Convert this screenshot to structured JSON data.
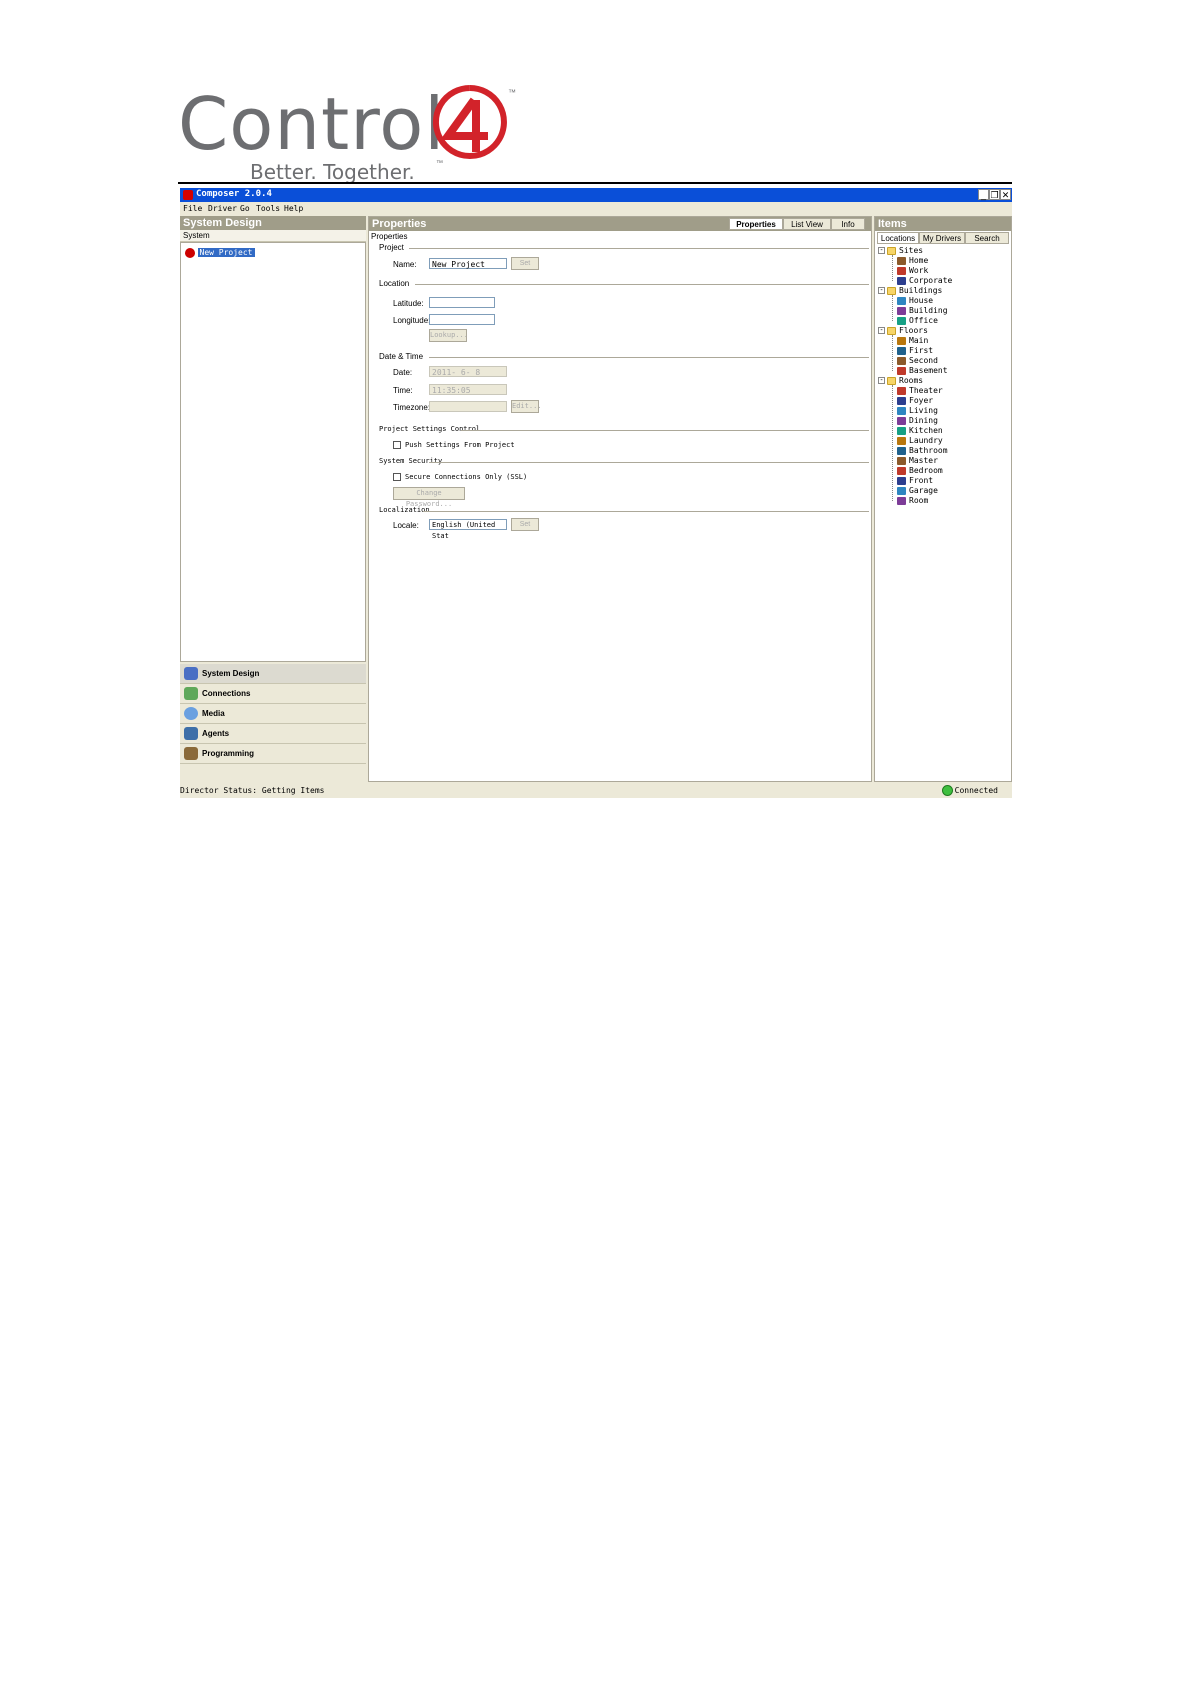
{
  "logo": {
    "word": "Control",
    "tagline": "Better. Together.",
    "tm": "™"
  },
  "window": {
    "title": "Composer 2.0.4"
  },
  "menu": [
    "File",
    "Driver",
    "Go",
    "Tools",
    "Help"
  ],
  "left": {
    "header": "System Design",
    "subheader": "System",
    "tree_root": "New Project",
    "nav": [
      "System Design",
      "Connections",
      "Media",
      "Agents",
      "Programming"
    ]
  },
  "center": {
    "header": "Properties",
    "tabs": [
      "Properties",
      "List View",
      "Info"
    ],
    "subheader": "Properties",
    "project": {
      "group": "Project",
      "name_label": "Name:",
      "name_value": "New Project",
      "set": "Set"
    },
    "location": {
      "group": "Location",
      "lat_label": "Latitude:",
      "lon_label": "Longitude:",
      "lookup": "Lookup..."
    },
    "datetime": {
      "group": "Date & Time",
      "date_label": "Date:",
      "date_value": "2011- 6- 8",
      "time_label": "Time:",
      "time_value": "11:35:05",
      "tz_label": "Timezone:",
      "edit": "Edit..."
    },
    "settings": {
      "group": "Project Settings Control",
      "push": "Push Settings From Project"
    },
    "security": {
      "group": "System Security",
      "secure": "Secure Connections Only (SSL)",
      "change": "Change Password..."
    },
    "localization": {
      "group": "Localization",
      "locale_label": "Locale:",
      "locale_value": "English (United Stat",
      "set": "Set"
    }
  },
  "right": {
    "header": "Items",
    "tabs": [
      "Locations",
      "My Drivers",
      "Search"
    ],
    "tree": [
      {
        "label": "Sites",
        "children": [
          "Home",
          "Work",
          "Corporate"
        ]
      },
      {
        "label": "Buildings",
        "children": [
          "House",
          "Building",
          "Office"
        ]
      },
      {
        "label": "Floors",
        "children": [
          "Main",
          "First",
          "Second",
          "Basement"
        ]
      },
      {
        "label": "Rooms",
        "children": [
          "Theater",
          "Foyer",
          "Living",
          "Dining",
          "Kitchen",
          "Laundry",
          "Bathroom",
          "Master",
          "Bedroom",
          "Front",
          "Garage",
          "Room"
        ]
      }
    ]
  },
  "status": {
    "text": "Director Status: Getting Items",
    "connection": "Connected"
  },
  "colors": {
    "titlebar": "#0a4fd8",
    "panel_header": "#a09d89",
    "logo_red": "#d2232a",
    "logo_gray": "#6d6e71"
  }
}
